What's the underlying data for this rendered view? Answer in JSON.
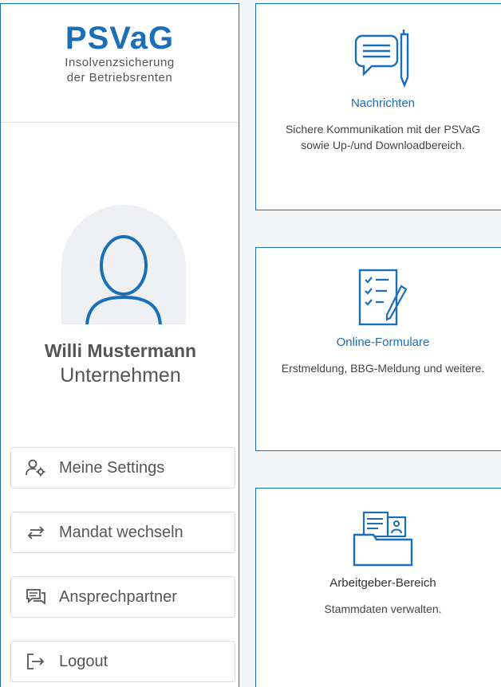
{
  "logo": {
    "title": "PSVaG",
    "subtitle_line1": "Insolvenzsicherung",
    "subtitle_line2": "der Betriebsrenten"
  },
  "user": {
    "name": "Willi Mustermann",
    "role": "Unternehmen"
  },
  "sidebar": {
    "buttons": [
      {
        "label": "Meine Settings",
        "icon": "user-settings-icon"
      },
      {
        "label": "Mandat wechseln",
        "icon": "swap-arrows-icon"
      },
      {
        "label": "Ansprechpartner",
        "icon": "chat-bubbles-icon"
      },
      {
        "label": "Logout",
        "icon": "logout-icon"
      }
    ]
  },
  "cards": [
    {
      "title": "Nachrichten",
      "description": "Sichere Kommunikation mit der PSVaG sowie Up-/und Downloadbereich.",
      "icon": "message-pencil-icon"
    },
    {
      "title": "Online-Formulare",
      "description": "Erstmeldung, BBG-Meldung und weitere.",
      "icon": "checklist-form-icon"
    },
    {
      "title": "Arbeitgeber-Bereich",
      "description": "Stammdaten verwalten.",
      "icon": "folder-documents-icon"
    }
  ],
  "colors": {
    "brand": "#1b6fb7",
    "text": "#555555",
    "border": "#d9dde2",
    "background": "#f4f5f7"
  }
}
